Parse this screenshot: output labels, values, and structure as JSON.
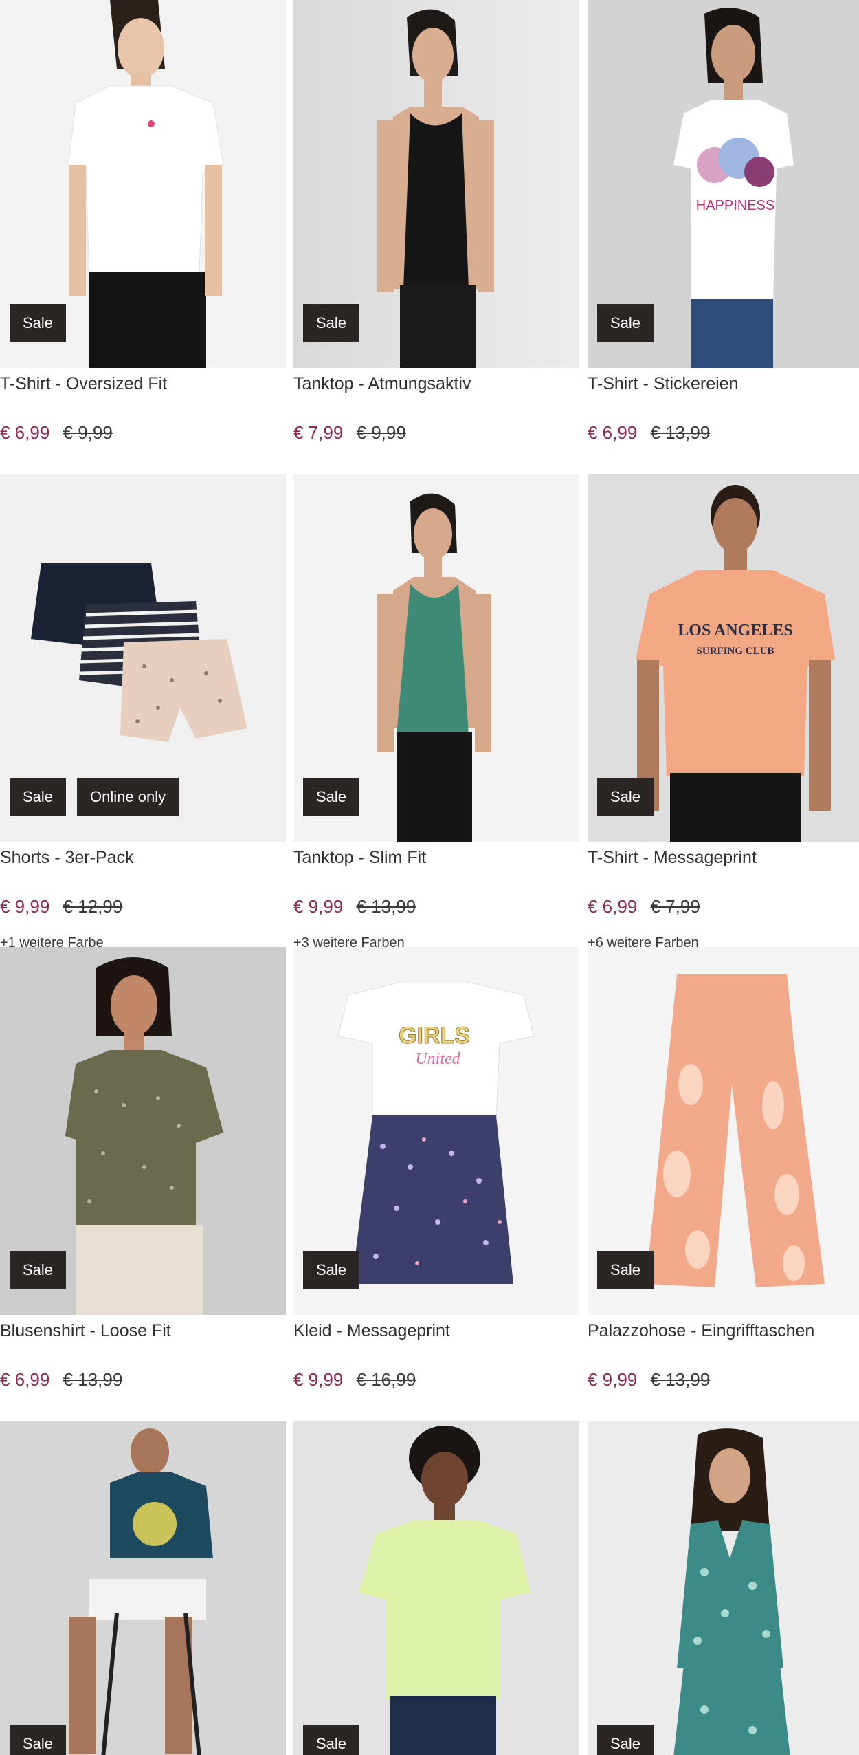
{
  "products": [
    {
      "name": "T-Shirt - Oversized Fit",
      "price": "€ 6,99",
      "old_price": "€ 9,99",
      "badges": [
        "Sale"
      ],
      "colors": "",
      "image": "woman-white-tshirt"
    },
    {
      "name": "Tanktop - Atmungsaktiv",
      "price": "€ 7,99",
      "old_price": "€ 9,99",
      "badges": [
        "Sale"
      ],
      "colors": "",
      "image": "woman-black-tanktop"
    },
    {
      "name": "T-Shirt - Stickereien",
      "price": "€ 6,99",
      "old_price": "€ 13,99",
      "badges": [
        "Sale"
      ],
      "colors": "",
      "image": "woman-white-print-tshirt"
    },
    {
      "name": "Shorts - 3er-Pack",
      "price": "€ 9,99",
      "old_price": "€ 12,99",
      "badges": [
        "Sale",
        "Online only"
      ],
      "colors": "+1 weitere Farbe",
      "image": "three-shorts"
    },
    {
      "name": "Tanktop - Slim Fit",
      "price": "€ 9,99",
      "old_price": "€ 13,99",
      "badges": [
        "Sale"
      ],
      "colors": "+3 weitere Farben",
      "image": "woman-green-tanktop"
    },
    {
      "name": "T-Shirt - Messageprint",
      "price": "€ 6,99",
      "old_price": "€ 7,99",
      "badges": [
        "Sale"
      ],
      "colors": "+6 weitere Farben",
      "image": "man-peach-tshirt"
    },
    {
      "name": "Blusenshirt - Loose Fit",
      "price": "€ 6,99",
      "old_price": "€ 13,99",
      "badges": [
        "Sale"
      ],
      "colors": "",
      "image": "woman-olive-blouse"
    },
    {
      "name": "Kleid - Messageprint",
      "price": "€ 9,99",
      "old_price": "€ 16,99",
      "badges": [
        "Sale"
      ],
      "colors": "",
      "image": "girls-dress"
    },
    {
      "name": "Palazzohose - Eingrifftaschen",
      "price": "€ 9,99",
      "old_price": "€ 13,99",
      "badges": [
        "Sale"
      ],
      "colors": "",
      "image": "orange-palazzo-pants"
    },
    {
      "name": "",
      "price": "",
      "old_price": "",
      "badges": [
        "Sale"
      ],
      "colors": "",
      "image": "man-blue-tshirt"
    },
    {
      "name": "",
      "price": "",
      "old_price": "",
      "badges": [
        "Sale"
      ],
      "colors": "",
      "image": "woman-lime-shirt"
    },
    {
      "name": "",
      "price": "",
      "old_price": "",
      "badges": [
        "Sale"
      ],
      "colors": "",
      "image": "woman-patterned-top"
    }
  ],
  "colors": {
    "sale_price": "#8e2a55",
    "badge_bg": "#2b2623",
    "badge_text": "#ffffff"
  }
}
